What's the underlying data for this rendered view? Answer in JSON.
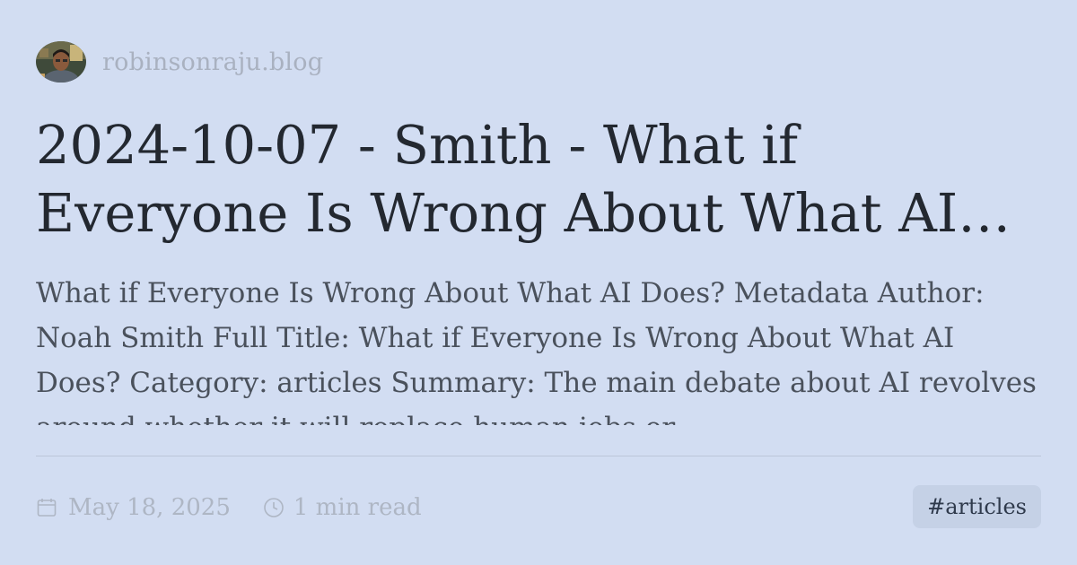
{
  "header": {
    "site_name": "robinsonraju.blog",
    "avatar_icon": "avatar-photo"
  },
  "post": {
    "title": "2024-10-07 - Smith - What if Everyone Is Wrong About What AI Does?",
    "description": "What if Everyone Is Wrong About What AI Does? Metadata Author: Noah Smith Full Title: What if Everyone Is Wrong About What AI Does? Category: articles Summary: The main debate about AI revolves around whether it will replace human jobs or"
  },
  "meta": {
    "date": "May 18, 2025",
    "date_icon": "calendar-icon",
    "read_time": "1 min read",
    "read_icon": "clock-icon"
  },
  "tag": {
    "label": "#articles"
  },
  "colors": {
    "background": "#d2ddf2",
    "title": "#232830",
    "description": "#4a515c",
    "muted": "#aeb6c4",
    "tag_bg": "#c5d1e6"
  }
}
